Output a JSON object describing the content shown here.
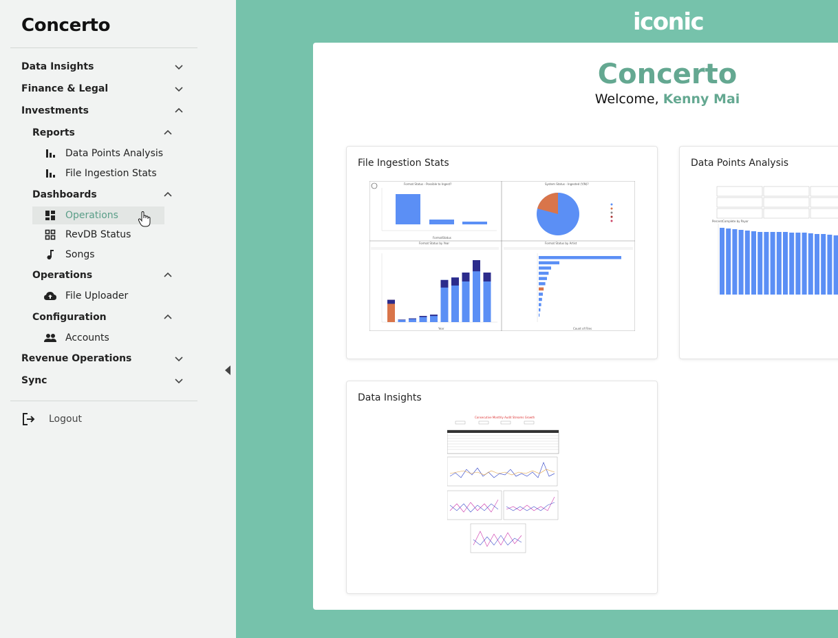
{
  "sidebar": {
    "brand": "Concerto",
    "nav": [
      {
        "label": "Data Insights",
        "expanded": false
      },
      {
        "label": "Finance & Legal",
        "expanded": false
      },
      {
        "label": "Investments",
        "expanded": true
      },
      {
        "label": "Revenue Operations",
        "expanded": false
      },
      {
        "label": "Sync",
        "expanded": false
      }
    ],
    "groups": [
      {
        "label": "Reports",
        "items": [
          {
            "label": "Data Points Analysis",
            "icon": "bar-chart-icon"
          },
          {
            "label": "File Ingestion Stats",
            "icon": "bar-chart-icon"
          }
        ]
      },
      {
        "label": "Dashboards",
        "items": [
          {
            "label": "Operations",
            "icon": "dashboard-icon",
            "active": true
          },
          {
            "label": "RevDB Status",
            "icon": "dashboard-outline-icon"
          },
          {
            "label": "Songs",
            "icon": "music-note-icon"
          }
        ]
      },
      {
        "label": "Operations",
        "items": [
          {
            "label": "File Uploader",
            "icon": "cloud-upload-icon"
          }
        ]
      },
      {
        "label": "Configuration",
        "items": [
          {
            "label": "Accounts",
            "icon": "people-icon"
          }
        ]
      }
    ],
    "logout": "Logout"
  },
  "header": {
    "logo": "iconic",
    "title": "Concerto",
    "welcome_prefix": "Welcome,",
    "user_name": "Kenny Mai"
  },
  "cards": [
    {
      "title": "File Ingestion Stats"
    },
    {
      "title": "Data Points Analysis"
    },
    {
      "title": "Data Insights"
    }
  ],
  "thumbnails": {
    "ingestion": {
      "q1_title": "Format Status - Possible to Ingest?",
      "q2_title": "System Status - Ingested (Y/N)?",
      "q3_title": "Format Status by Year",
      "q4_title": "Format Status by Artist",
      "xlabel_q1": "FormatStatus",
      "xlabel_q3": "Year",
      "xlabel_q4": "Count of Files",
      "bars_q3": [
        18,
        2,
        3,
        5,
        6,
        34,
        36,
        40,
        50,
        40
      ],
      "bars_q4": [
        100,
        25,
        15,
        12,
        10,
        8,
        6,
        5,
        4,
        3,
        2,
        1
      ]
    },
    "datapoints": {
      "chart_title": "PercentComplete by Payor",
      "bars": [
        97,
        96,
        95,
        94,
        93,
        92,
        91,
        91,
        91,
        91,
        91,
        90,
        90,
        90,
        89,
        88,
        88,
        87,
        86
      ]
    },
    "insights": {
      "title": "Consecutive Monthly Audit Streams Growth"
    }
  },
  "colors": {
    "accent": "#64a891",
    "background": "#76c2ab",
    "bar_blue": "#5b8ff5",
    "bar_orange": "#d9754a",
    "bar_navy": "#2c2c8c"
  }
}
